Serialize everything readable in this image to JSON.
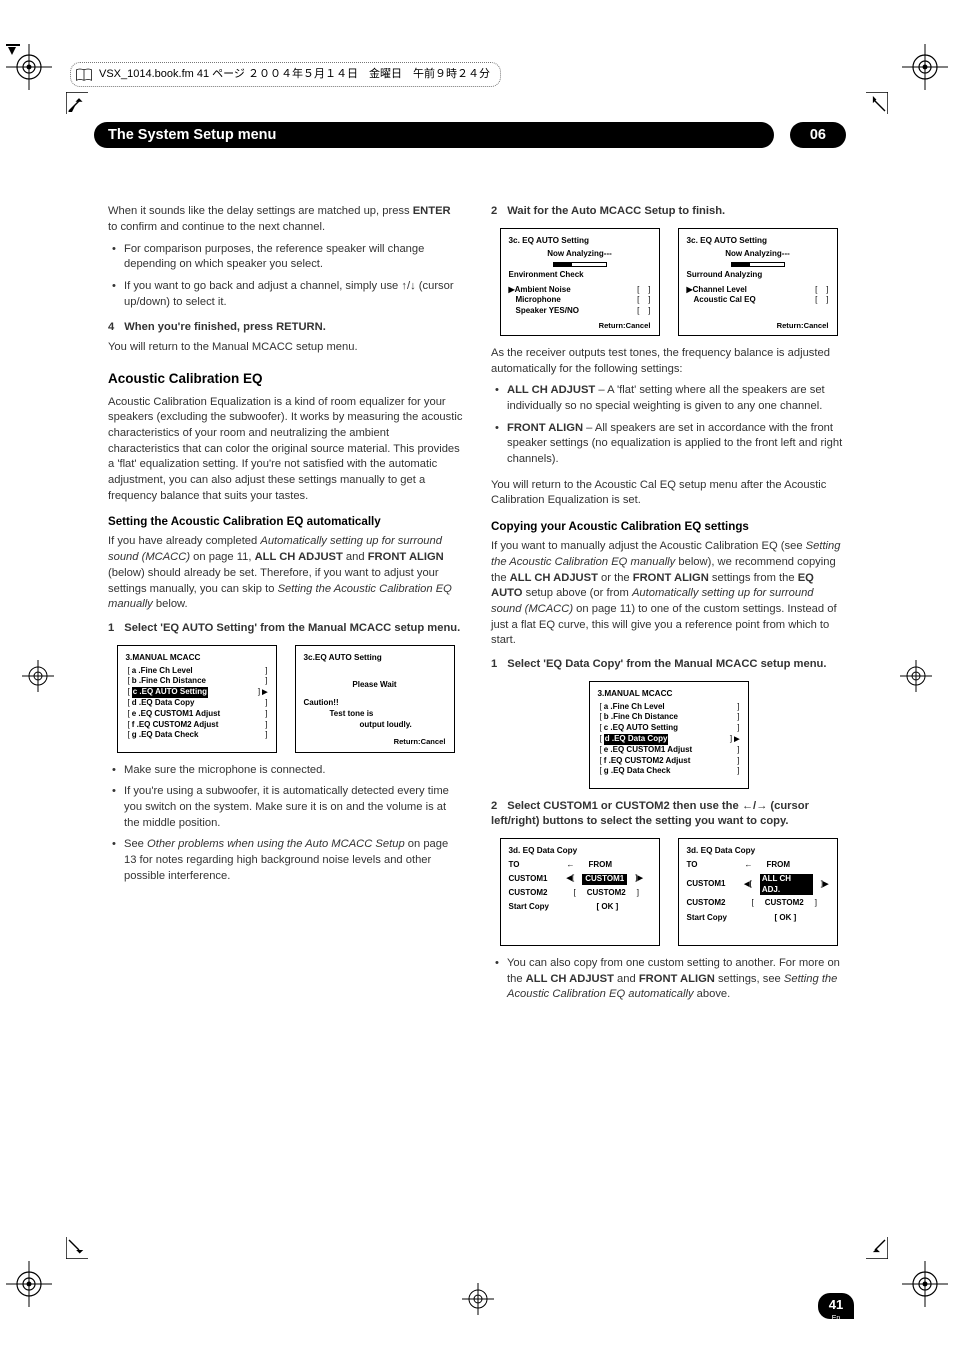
{
  "file_header": "VSX_1014.book.fm  41 ページ  ２００４年５月１４日　金曜日　午前９時２４分",
  "chapter": {
    "title": "The System Setup menu",
    "num": "06"
  },
  "left": {
    "intro": "When it sounds like the delay settings are matched up, press ",
    "intro_bold": "ENTER",
    "intro2": " to confirm and continue to the next channel.",
    "bul1": "For comparison purposes, the reference speaker will change depending on which speaker you select.",
    "bul2a": "If you want to go back and adjust a channel, simply use ",
    "bul2_arrows": "↑/↓",
    "bul2b": " (cursor up/down) to select it.",
    "step4": "When you're finished, press RETURN.",
    "step4n": "4",
    "after4": "You will return to the Manual MCACC setup menu.",
    "h2_aceq": "Acoustic Calibration EQ",
    "aceq_p": "Acoustic Calibration Equalization is a kind of room equalizer for your speakers (excluding the subwoofer). It works by measuring the acoustic characteristics of your room and neutralizing the ambient characteristics that can color the original source material. This provides a 'flat' equalization setting. If you're not satisfied with the automatic adjustment, you can also adjust these settings manually to get a frequency balance that suits your tastes.",
    "h3_auto": "Setting the Acoustic Calibration EQ automatically",
    "auto_p1a": "If you have already completed ",
    "auto_p1_it1": "Automatically setting up for surround sound (MCACC)",
    "auto_p1b": " on page 11, ",
    "auto_p1_bold1": "ALL CH ADJUST",
    "auto_p1c": " and ",
    "auto_p1_bold2": "FRONT ALIGN",
    "auto_p1d": " (below) should already be set. Therefore, if you want to adjust your settings manually, you can skip to ",
    "auto_p1_it2": "Setting the Acoustic Calibration EQ manually",
    "auto_p1e": " below.",
    "step1n": "1",
    "step1": "Select 'EQ AUTO Setting' from the Manual MCACC setup menu.",
    "bul_mic": "Make sure the microphone is connected.",
    "bul_sub": "If you're using a subwoofer, it is automatically detected every time you switch on the system. Make sure it is on and the volume is at the middle position.",
    "bul_see_a": "See ",
    "bul_see_it": "Other problems when using the Auto MCACC Setup",
    "bul_see_b": " on page 13 for notes regarding high background noise levels and other possible interference.",
    "osd1": {
      "title": "3.MANUAL MCACC",
      "a": "a .Fine Ch Level",
      "b": "b .Fine Ch Distance",
      "c": "c .EQ AUTO Setting",
      "d": "d .EQ Data Copy",
      "e": "e .EQ CUSTOM1 Adjust",
      "f": "f .EQ CUSTOM2 Adjust",
      "g": "g .EQ Data Check"
    },
    "osd2": {
      "title": "3c.EQ AUTO Setting",
      "pw": "Please Wait",
      "caution": "Caution!!",
      "l1": "Test tone is",
      "l2": "output loudly.",
      "ret": "Return:Cancel"
    }
  },
  "right": {
    "step2n": "2",
    "step2": "Wait for the Auto MCACC Setup to finish.",
    "osd1": {
      "title": "3c. EQ AUTO Setting",
      "now": "Now Analyzing---",
      "env": "Environment Check",
      "a": "Ambient Noise",
      "b": "Microphone",
      "c": "Speaker YES/NO",
      "ret": "Return:Cancel"
    },
    "osd2": {
      "title": "3c. EQ AUTO Setting",
      "now": "Now Analyzing---",
      "sur": "Surround Analyzing",
      "a": "Channel Level",
      "b": "Acoustic Cal EQ",
      "ret": "Return:Cancel"
    },
    "p_after": "As the receiver outputs test tones, the frequency balance is adjusted automatically for the following settings:",
    "all_bold": "ALL CH ADJUST",
    "all_txt": " – A 'flat' setting where all the speakers are set individually so no special weighting is given to any one channel.",
    "front_bold": "FRONT ALIGN",
    "front_txt": " – All speakers are set in accordance with the front speaker settings (no equalization is applied to the front left and right channels).",
    "return_p": "You will return to the Acoustic Cal EQ setup menu after the Acoustic Calibration Equalization is set.",
    "h3_copy": "Copying your Acoustic Calibration EQ settings",
    "copy_p_a": "If you want to manually adjust the Acoustic Calibration EQ (see ",
    "copy_it1": "Setting the Acoustic Calibration EQ manually",
    "copy_p_b": " below), we recommend copying the ",
    "copy_b1": "ALL CH ADJUST",
    "copy_p_c": " or the ",
    "copy_b2": "FRONT ALIGN",
    "copy_p_d": " settings from the ",
    "copy_b3": "EQ AUTO",
    "copy_p_e": " setup above (or from ",
    "copy_it2": "Automatically setting up for surround sound (MCACC)",
    "copy_p_f": " on page 11) to one of the custom settings. Instead of just a flat EQ curve, this will give you a reference point from which to start.",
    "c_step1n": "1",
    "c_step1": "Select 'EQ Data Copy' from the Manual MCACC setup menu.",
    "osd3": {
      "title": "3.MANUAL MCACC",
      "a": "a .Fine Ch Level",
      "b": "b .Fine Ch Distance",
      "c": "c .EQ AUTO Setting",
      "d": "d .EQ Data Copy",
      "e": "e .EQ CUSTOM1 Adjust",
      "f": "f .EQ CUSTOM2 Adjust",
      "g": "g .EQ Data Check"
    },
    "c_step2n": "2",
    "c_step2a": "Select CUSTOM1 or CUSTOM2 then use the ",
    "c_step2_arrows": "←/→",
    "c_step2b": " (cursor left/right) buttons to select the setting you want to copy.",
    "osd4": {
      "title": "3d. EQ Data Copy",
      "to": "TO",
      "from": "FROM",
      "arrow": "←",
      "c1": "CUSTOM1",
      "c2": "CUSTOM2",
      "c1s": "CUSTOM1",
      "c2s": "CUSTOM2",
      "start": "Start Copy",
      "ok": "[  OK  ]"
    },
    "osd5": {
      "title": "3d. EQ Data Copy",
      "to": "TO",
      "from": "FROM",
      "arrow": "←",
      "c1": "CUSTOM1",
      "c2": "CUSTOM2",
      "alladj": "ALL CH ADJ.",
      "c2s": "CUSTOM2",
      "start": "Start Copy",
      "ok": "[  OK  ]"
    },
    "final_a": "You can also copy from one custom setting to another. For more on the ",
    "final_b1": "ALL CH ADJUST",
    "final_b": " and ",
    "final_b2": "FRONT ALIGN",
    "final_c": " settings, see ",
    "final_it": "Setting the Acoustic Calibration EQ automatically",
    "final_d": " above."
  },
  "pagenum": {
    "num": "41",
    "lang": "En"
  }
}
